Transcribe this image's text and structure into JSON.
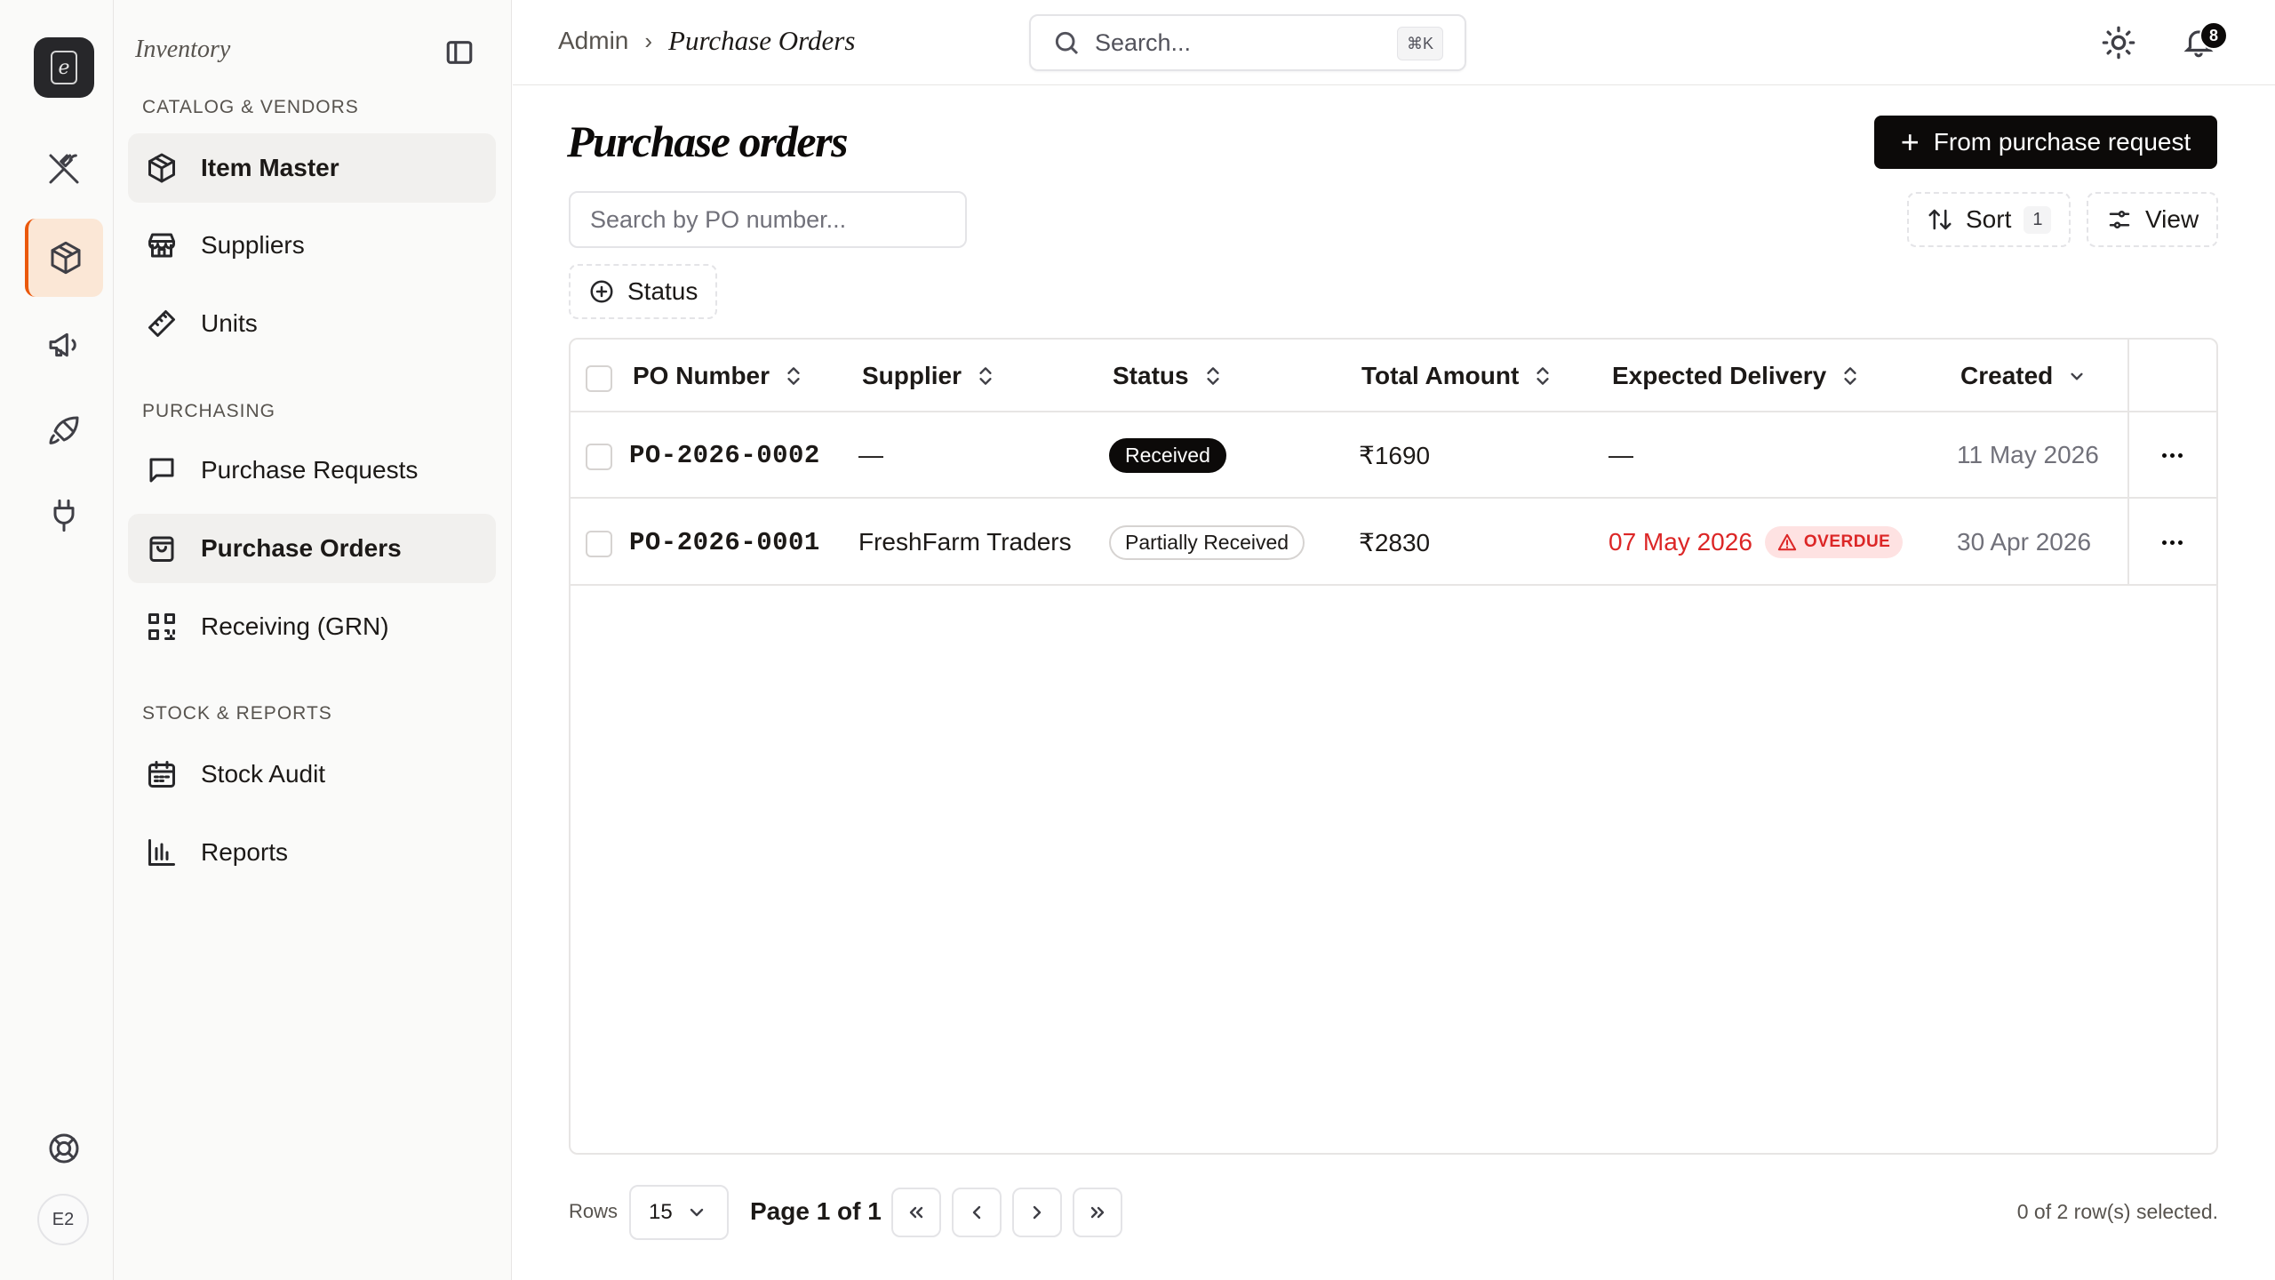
{
  "rail": {
    "logo_letter": "e",
    "avatar": "E2",
    "items": [
      {
        "icon": "utensils-crossed-icon"
      },
      {
        "icon": "package-icon",
        "active": true
      },
      {
        "icon": "megaphone-icon"
      },
      {
        "icon": "rocket-icon"
      },
      {
        "icon": "plug-icon"
      },
      {
        "icon": "life-buoy-icon"
      }
    ]
  },
  "sidebar": {
    "title": "Inventory",
    "sections": [
      {
        "label": "CATALOG & VENDORS",
        "items": [
          "Item Master",
          "Suppliers",
          "Units"
        ]
      },
      {
        "label": "PURCHASING",
        "items": [
          "Purchase Requests",
          "Purchase Orders",
          "Receiving (GRN)"
        ]
      },
      {
        "label": "STOCK & REPORTS",
        "items": [
          "Stock Audit",
          "Reports"
        ]
      }
    ]
  },
  "topbar": {
    "breadcrumb": [
      "Admin",
      "Purchase Orders"
    ],
    "search_placeholder": "Search...",
    "search_shortcut": "⌘K",
    "notification_count": "8"
  },
  "main": {
    "title": "Purchase orders",
    "primary_action": "From purchase request",
    "search_placeholder": "Search by PO number...",
    "filter_status": "Status",
    "sort_label": "Sort",
    "sort_count": "1",
    "view_label": "View"
  },
  "table": {
    "columns": [
      "PO Number",
      "Supplier",
      "Status",
      "Total Amount",
      "Expected Delivery",
      "Created"
    ],
    "rows": [
      {
        "po_number": "PO-2026-0002",
        "supplier": "—",
        "status": "Received",
        "total": "₹1690",
        "expected": "—",
        "overdue": "",
        "created": "11 May 2026"
      },
      {
        "po_number": "PO-2026-0001",
        "supplier": "FreshFarm Traders",
        "status": "Partially Received",
        "total": "₹2830",
        "expected": "07 May 2026",
        "overdue": "OVERDUE",
        "created": "30 Apr 2026"
      }
    ]
  },
  "footer": {
    "rows_label": "Rows",
    "rows_value": "15",
    "page_info": "Page 1 of 1",
    "selected_info": "0 of 2 row(s) selected."
  },
  "colors": {
    "accent": "#ea580c",
    "accent_bg": "#fbe7d6",
    "overdue_text": "#dc2626",
    "overdue_bg": "#fee2e2",
    "primary": "#0c0a09"
  }
}
